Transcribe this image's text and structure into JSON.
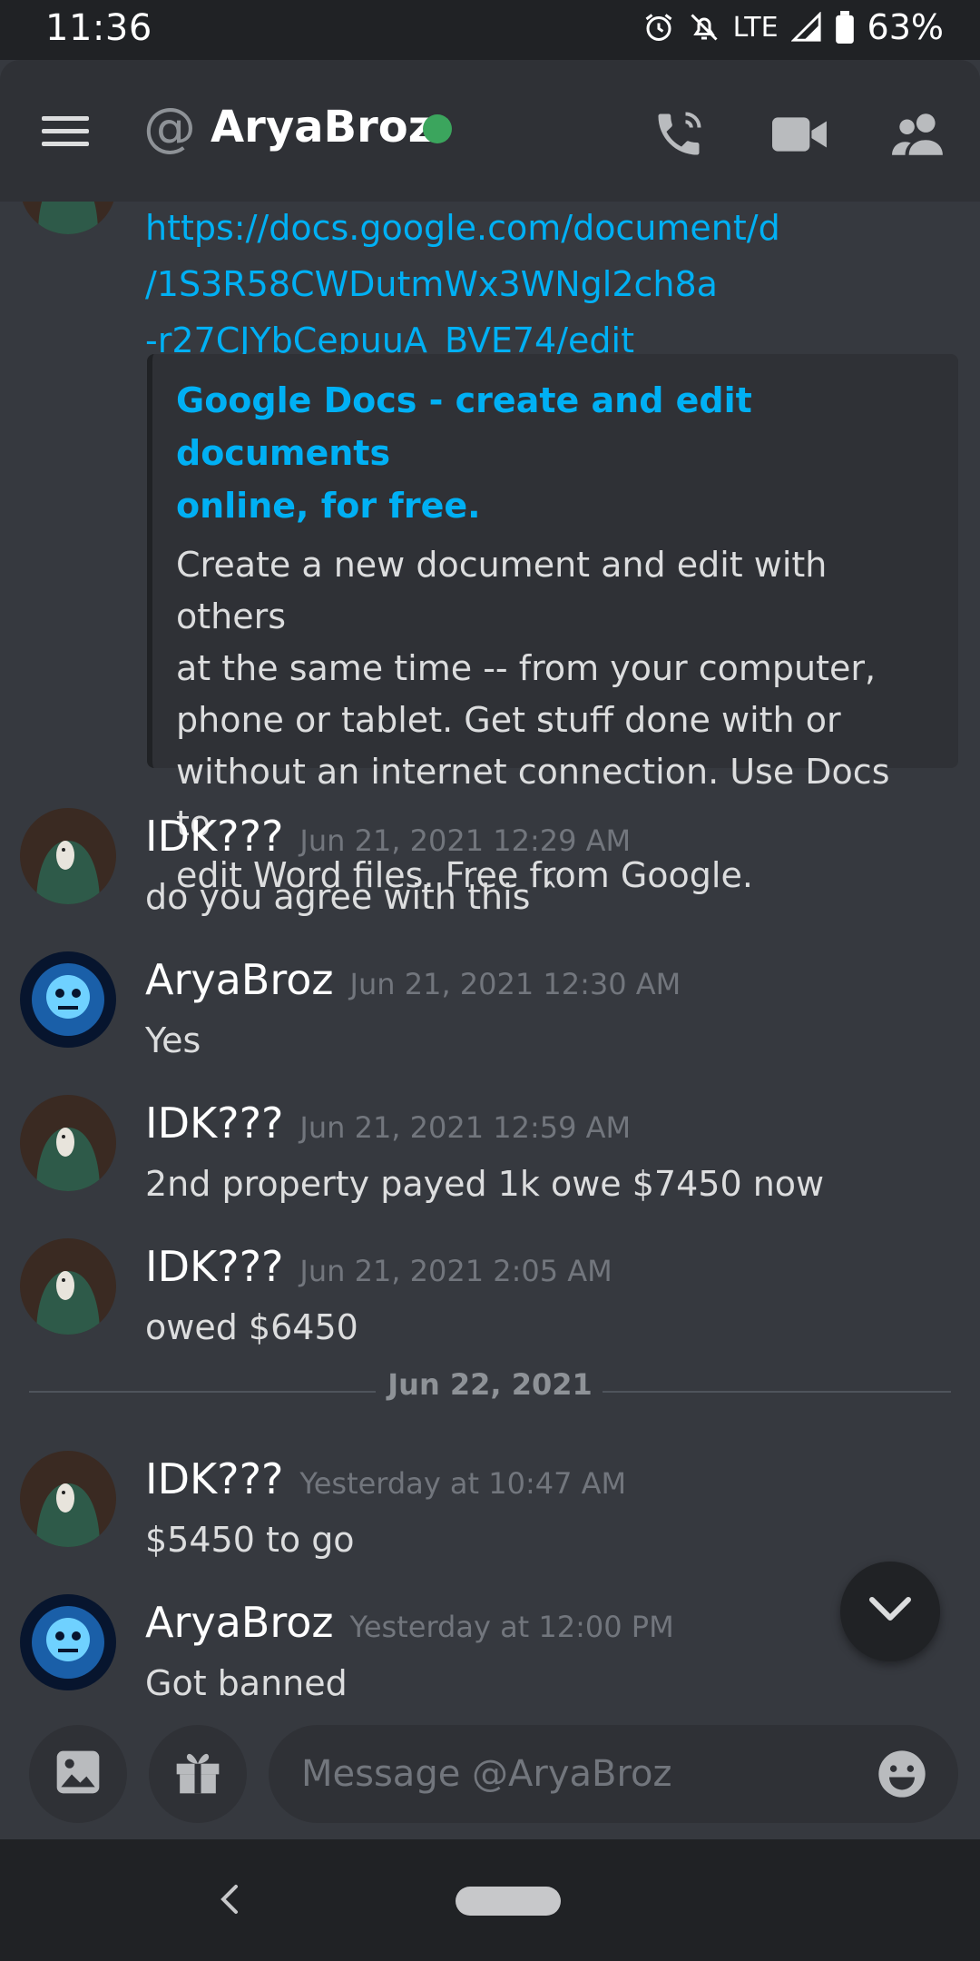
{
  "status_bar": {
    "time": "11:36",
    "network": "LTE",
    "battery": "63%"
  },
  "header": {
    "at_symbol": "@",
    "title": "AryaBroz",
    "presence_color": "#3ba55d"
  },
  "messages": {
    "link_lines": [
      "https://docs.google.com/document/d",
      "/1S3R58CWDutmWx3WNgl2ch8a",
      "-r27CJYbCepuuA_BVE74/edit"
    ],
    "embed": {
      "title_lines": [
        "Google Docs - create and edit documents",
        "online, for free."
      ],
      "description_lines": [
        "Create a new document and edit with others",
        "at the same time -- from your computer,",
        "phone or tablet. Get stuff done with or",
        "without an internet connection. Use Docs to",
        "edit Word files. Free from Google."
      ]
    },
    "items": [
      {
        "author": "IDK???",
        "timestamp": "Jun 21, 2021 12:29 AM",
        "text": "do you agree with this ˆ"
      },
      {
        "author": "AryaBroz",
        "timestamp": "Jun 21, 2021 12:30 AM",
        "text": "Yes"
      },
      {
        "author": "IDK???",
        "timestamp": "Jun 21, 2021 12:59 AM",
        "text": "2nd property payed 1k owe $7450 now"
      },
      {
        "author": "IDK???",
        "timestamp": "Jun 21, 2021 2:05 AM",
        "text": "owed $6450"
      },
      {
        "author": "IDK???",
        "timestamp": "Yesterday at 10:47 AM",
        "text": "$5450 to go"
      },
      {
        "author": "AryaBroz",
        "timestamp": "Yesterday at 12:00 PM",
        "text": "Got banned"
      }
    ],
    "date_divider": "Jun 22, 2021"
  },
  "input": {
    "placeholder": "Message @AryaBroz"
  },
  "icons": {
    "menu": "hamburger-menu-icon",
    "call": "phone-call-icon",
    "video": "video-camera-icon",
    "members": "members-icon",
    "image": "image-icon",
    "gift": "gift-icon",
    "emoji": "emoji-icon",
    "jump": "chevron-down-icon",
    "back": "back-icon"
  },
  "colors": {
    "link": "#00b0f4",
    "background": "#36393f",
    "header": "#2f3136"
  }
}
